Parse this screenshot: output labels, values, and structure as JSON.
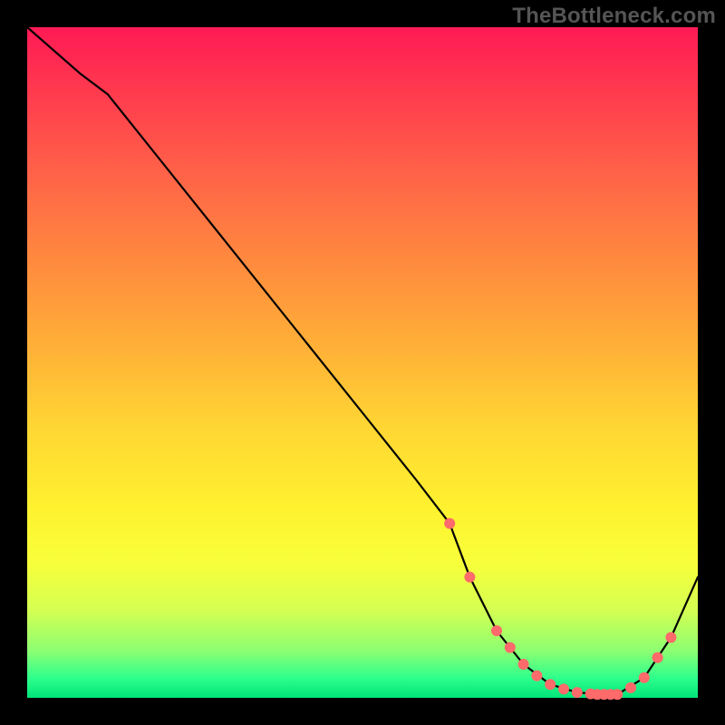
{
  "watermark": "TheBottleneck.com",
  "colors": {
    "dot": "#ff6a6a",
    "line": "#000000"
  },
  "chart_data": {
    "type": "line",
    "title": "",
    "xlabel": "",
    "ylabel": "",
    "xlim": [
      0,
      100
    ],
    "ylim": [
      0,
      100
    ],
    "grid": false,
    "series": [
      {
        "name": "curve",
        "x": [
          0,
          8,
          12,
          20,
          30,
          40,
          50,
          58,
          63,
          66,
          70,
          74,
          78,
          82,
          86,
          88,
          92,
          96,
          100
        ],
        "values": [
          100,
          93,
          90,
          80,
          67.5,
          55,
          42.5,
          32.5,
          26,
          18,
          10,
          5,
          2,
          0.8,
          0.5,
          0.5,
          3,
          9,
          18
        ]
      }
    ],
    "highlight_points": {
      "series": "curve",
      "x": [
        63,
        66,
        70,
        72,
        74,
        76,
        78,
        80,
        82,
        84,
        85,
        86,
        87,
        88,
        90,
        92,
        94,
        96
      ],
      "values": [
        26,
        18,
        10,
        7.5,
        5,
        3.3,
        2,
        1.3,
        0.8,
        0.6,
        0.5,
        0.5,
        0.5,
        0.5,
        1.5,
        3,
        6,
        9
      ]
    }
  }
}
